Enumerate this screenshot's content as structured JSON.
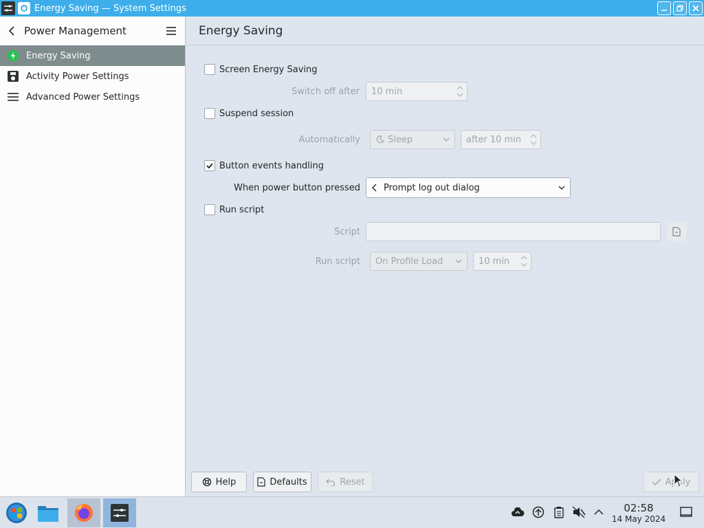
{
  "window": {
    "title": "Energy Saving — System Settings"
  },
  "sidebar": {
    "title": "Power Management",
    "items": [
      {
        "label": "Energy Saving",
        "icon": "battery-bolt-icon",
        "active": true
      },
      {
        "label": "Activity Power Settings",
        "icon": "activity-icon",
        "active": false
      },
      {
        "label": "Advanced Power Settings",
        "icon": "list-icon",
        "active": false
      }
    ]
  },
  "main": {
    "title": "Energy Saving",
    "screen_energy_saving": {
      "label": "Screen Energy Saving",
      "checked": false
    },
    "switch_off_after": {
      "label": "Switch off after",
      "value": "10 min"
    },
    "suspend_session": {
      "label": "Suspend session",
      "checked": false
    },
    "automatically": {
      "label": "Automatically",
      "action": "Sleep",
      "after": "after 10 min"
    },
    "button_events": {
      "label": "Button events handling",
      "checked": true
    },
    "power_button": {
      "label": "When power button pressed",
      "value": "Prompt log out dialog"
    },
    "run_script": {
      "label": "Run script",
      "checked": false
    },
    "script": {
      "label": "Script",
      "value": ""
    },
    "run_script_when": {
      "label": "Run script",
      "value": "On Profile Load",
      "time": "10 min"
    }
  },
  "buttons": {
    "help": "Help",
    "defaults": "Defaults",
    "reset": "Reset",
    "apply": "Apply"
  },
  "taskbar": {
    "time": "02:58",
    "date": "14 May 2024"
  },
  "colors": {
    "accent": "#3daee9",
    "sidebar_active": "#7f8c8d",
    "background": "#dfe5ee"
  }
}
